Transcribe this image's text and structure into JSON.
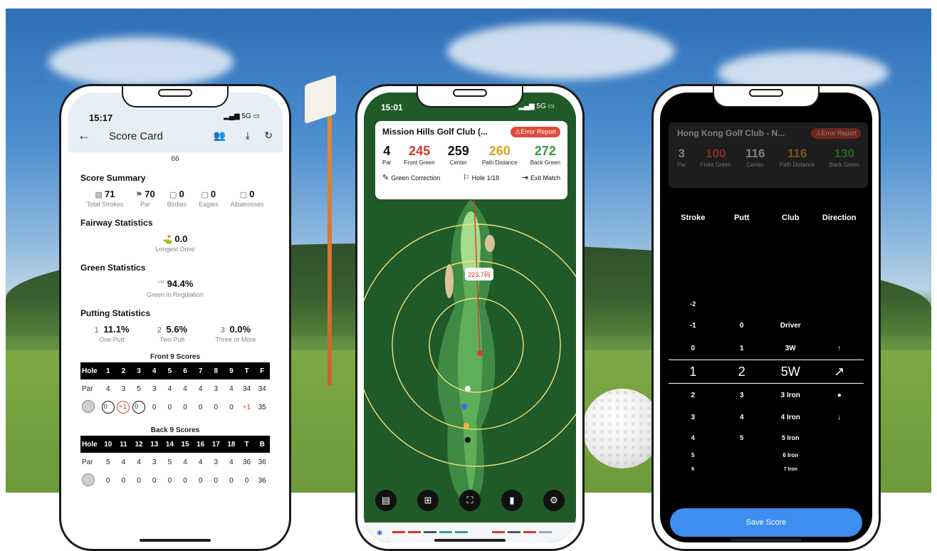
{
  "phone1": {
    "status": {
      "time": "15:17",
      "network": "5G"
    },
    "header": {
      "title": "Score Card"
    },
    "top_value": "66",
    "score_summary": {
      "title": "Score Summary",
      "items": [
        {
          "value": "71",
          "label": "Total Strokes",
          "icon": "chart-icon"
        },
        {
          "value": "70",
          "label": "Par",
          "icon": "flag-icon"
        },
        {
          "value": "0",
          "label": "Birdies",
          "icon": "one-box-icon"
        },
        {
          "value": "0",
          "label": "Eagles",
          "icon": "two-box-icon"
        },
        {
          "value": "0",
          "label": "Albatrosses",
          "icon": "three-box-icon"
        }
      ]
    },
    "fairway": {
      "title": "Fairway Statistics",
      "value": "0.0",
      "label": "Longest Drive"
    },
    "green": {
      "title": "Green Statistics",
      "value": "94.4%",
      "label": "Green in Regulation"
    },
    "putting": {
      "title": "Putting Statistics",
      "items": [
        {
          "badge": "1",
          "value": "11.1%",
          "label": "One Putt"
        },
        {
          "badge": "2",
          "value": "5.6%",
          "label": "Two Putt"
        },
        {
          "badge": "3",
          "value": "0.0%",
          "label": "Three or More"
        }
      ]
    },
    "front9": {
      "title": "Front 9 Scores",
      "header": [
        "Hole",
        "1",
        "2",
        "3",
        "4",
        "5",
        "6",
        "7",
        "8",
        "9",
        "T",
        "F"
      ],
      "par": [
        "Par",
        "4",
        "3",
        "5",
        "3",
        "4",
        "4",
        "4",
        "3",
        "4",
        "34",
        "34"
      ],
      "score": [
        "",
        "0",
        "+1",
        "0",
        "0",
        "0",
        "0",
        "0",
        "0",
        "0",
        "+1",
        "35"
      ]
    },
    "back9": {
      "title": "Back 9 Scores",
      "header": [
        "Hole",
        "10",
        "11",
        "12",
        "13",
        "14",
        "15",
        "16",
        "17",
        "18",
        "T",
        "B"
      ],
      "par": [
        "Par",
        "5",
        "4",
        "4",
        "3",
        "5",
        "4",
        "4",
        "3",
        "4",
        "36",
        "36"
      ],
      "score": [
        "",
        "0",
        "0",
        "0",
        "0",
        "0",
        "0",
        "0",
        "0",
        "0",
        "0",
        "36"
      ]
    }
  },
  "phone2": {
    "status": {
      "time": "15:01",
      "network": "5G"
    },
    "course": "Mission Hills Golf Club (...",
    "error_report": "Error Report",
    "distances": [
      {
        "value": "4",
        "label": "Par",
        "color": "#111111"
      },
      {
        "value": "245",
        "label": "Front Green",
        "color": "#d23b2e"
      },
      {
        "value": "259",
        "label": "Center",
        "color": "#111111"
      },
      {
        "value": "260",
        "label": "Path Distance",
        "color": "#e0a020"
      },
      {
        "value": "272",
        "label": "Back Green",
        "color": "#3a9a3a"
      }
    ],
    "actions": {
      "green_correction": "Green Correction",
      "hole": "Hole 1/18",
      "exit": "Exit Match"
    },
    "map_label": "223.7码",
    "toolbar": [
      "document-icon",
      "grid-icon",
      "focus-icon",
      "map-icon",
      "settings-icon"
    ]
  },
  "phone3": {
    "status": {
      "time": "15:15"
    },
    "course": "Hong Kong Golf Club - N...",
    "error_report": "Error Report",
    "distances": [
      {
        "value": "3",
        "label": "Par",
        "color": "#ffffff"
      },
      {
        "value": "100",
        "label": "Front Green",
        "color": "#ff5a4a"
      },
      {
        "value": "116",
        "label": "Center",
        "color": "#ffffff"
      },
      {
        "value": "116",
        "label": "Path Distance",
        "color": "#f0b030"
      },
      {
        "value": "130",
        "label": "Back Green",
        "color": "#4ac04a"
      }
    ],
    "columns": [
      "Stroke",
      "Putt",
      "Club",
      "Direction"
    ],
    "picker_rows": [
      {
        "cells": [
          "-2",
          "",
          "",
          ""
        ]
      },
      {
        "cells": [
          "-1",
          "0",
          "Driver",
          ""
        ]
      },
      {
        "cells": [
          "0",
          "1",
          "3W",
          "↑"
        ]
      },
      {
        "cells": [
          "1",
          "2",
          "5W",
          "↗"
        ],
        "selected": true
      },
      {
        "cells": [
          "2",
          "3",
          "3 Iron",
          "●"
        ]
      },
      {
        "cells": [
          "3",
          "4",
          "4 Iron",
          "↓"
        ]
      },
      {
        "cells": [
          "4",
          "5",
          "5 Iron",
          ""
        ]
      },
      {
        "cells": [
          "5",
          "",
          "6 Iron",
          ""
        ]
      },
      {
        "cells": [
          "6",
          "",
          "7 Iron",
          ""
        ]
      }
    ],
    "save_label": "Save Score"
  }
}
